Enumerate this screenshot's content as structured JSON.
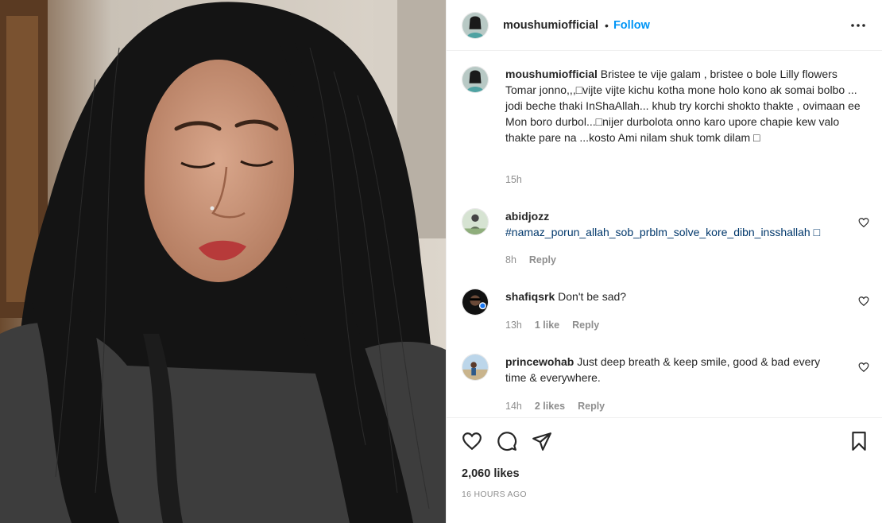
{
  "post": {
    "author": "moushumiofficial",
    "separator": "•",
    "follow_label": "Follow",
    "caption": {
      "username": "moushumiofficial",
      "text": "Bristee te vije galam , bristee o bole Lilly flowers Tomar jonno,,,□vijte vijte kichu kotha mone holo kono ak somai bolbo ... jodi beche thaki InShaAllah... khub try korchi shokto thakte , ovimaan ee Mon boro durbol...□nijer durbolota onno karo upore chapie kew valo thakte pare na ...kosto Ami nilam shuk tomk dilam □",
      "time": "15h"
    },
    "comments": [
      {
        "username": "abidjozz",
        "text": "#namaz_porun_allah_sob_prblm_solve_kore_dibn_insshallah □",
        "time": "8h",
        "likes": "",
        "reply": "Reply"
      },
      {
        "username": "shafiqsrk",
        "text": "Don't be sad?",
        "time": "13h",
        "likes": "1 like",
        "reply": "Reply"
      },
      {
        "username": "princewohab",
        "text": "Just deep breath & keep smile, good & bad every time & everywhere.",
        "time": "14h",
        "likes": "2 likes",
        "reply": "Reply"
      }
    ],
    "likes_count": "2,060 likes",
    "posted_ago": "16 HOURS AGO"
  },
  "icons": {
    "more": "more-options-icon",
    "heart": "heart-icon",
    "comment": "comment-icon",
    "share": "share-icon",
    "save": "bookmark-icon"
  },
  "colors": {
    "accent": "#0095f6",
    "hashtag": "#00376b",
    "muted": "#8e8e8e"
  }
}
